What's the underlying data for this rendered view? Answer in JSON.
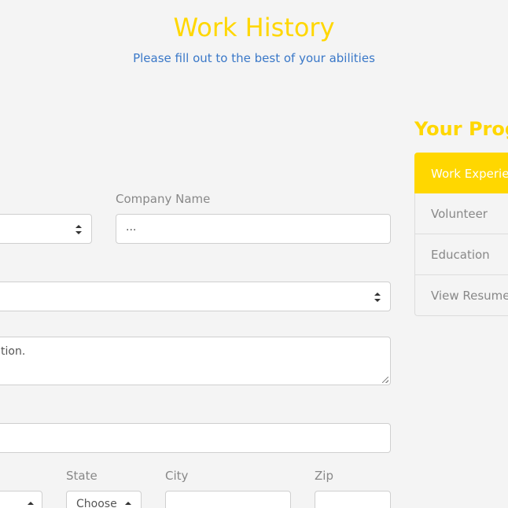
{
  "header": {
    "title": "Work History",
    "subtitle": "Please fill out to the best of your abilities"
  },
  "form": {
    "company_name_label": "Company Name",
    "company_name_value": "...",
    "description_value": "tion.",
    "state_label": "State",
    "state_value": "Choose",
    "city_label": "City",
    "zip_label": "Zip"
  },
  "progress": {
    "title": "Your Progress",
    "items": [
      {
        "label": "Work Experience",
        "active": true
      },
      {
        "label": "Volunteer",
        "active": false
      },
      {
        "label": "Education",
        "active": false
      },
      {
        "label": "View Resume",
        "active": false
      }
    ]
  },
  "colors": {
    "accent": "#ffd700",
    "subtitle": "#3a78c8",
    "background": "#f4f4f4"
  }
}
